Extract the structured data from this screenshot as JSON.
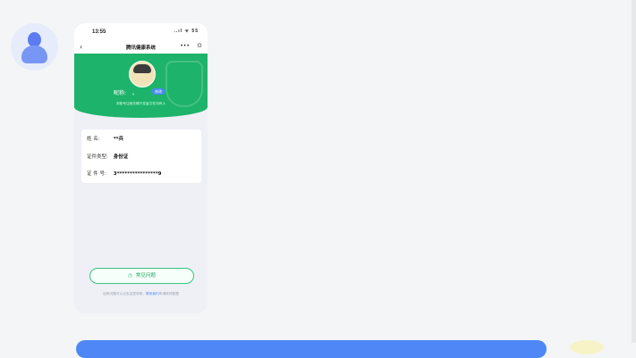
{
  "status_bar": {
    "time": "13:55",
    "icons": "..ıl ᯤ 55"
  },
  "navbar": {
    "back": "‹",
    "title": "腾讯健康系统",
    "more": "•••",
    "target": "⊙"
  },
  "profile": {
    "nickname_label": "昵称:",
    "nickname_value": "。",
    "badge": "修改",
    "note": "本账号注册关联开发者文件持有人"
  },
  "info": {
    "name_label": "姓 名:",
    "name_value": "**兵",
    "id_type_label": "证件类型:",
    "id_type_value": "身份证",
    "id_no_label": "证 件 号:",
    "id_no_value": "3****************9"
  },
  "faq": {
    "icon": "◷",
    "label": "常见问题"
  },
  "footer": {
    "text": "如有问题可以点击这里求助，",
    "link": "联系我们",
    "tail": "申请修改数据"
  }
}
